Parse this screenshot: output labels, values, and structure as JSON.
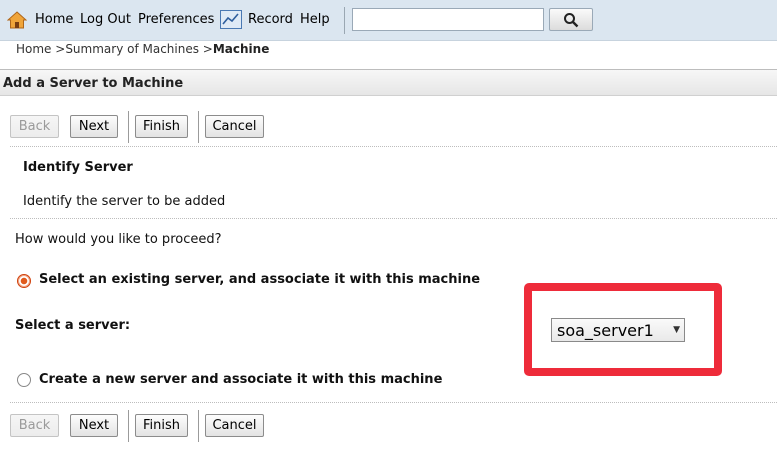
{
  "toolbar": {
    "home": "Home",
    "logout": "Log Out",
    "preferences": "Preferences",
    "record": "Record",
    "help": "Help",
    "search_value": "",
    "icons": [
      "home-icon",
      "record-icon",
      "magnifier-icon"
    ]
  },
  "breadcrumb": {
    "home": "Home >",
    "summary": "Summary of Machines >",
    "current": "Machine"
  },
  "page": {
    "title": "Add a Server to Machine",
    "step_title": "Identify Server",
    "step_desc": "Identify the server to be added",
    "question": "How would you like to proceed?",
    "option_existing": "Select an existing server, and associate it with this machine",
    "option_new": "Create a new server and associate it with this machine",
    "select_label": "Select a server:",
    "selected_server": "soa_server1",
    "selected_option": "existing"
  },
  "buttons": {
    "back": "Back",
    "next": "Next",
    "finish": "Finish",
    "cancel": "Cancel"
  },
  "colors": {
    "highlight": "#ee2b3a",
    "radio_selected": "#e05a1c",
    "topbar": "#dbe6f0"
  }
}
